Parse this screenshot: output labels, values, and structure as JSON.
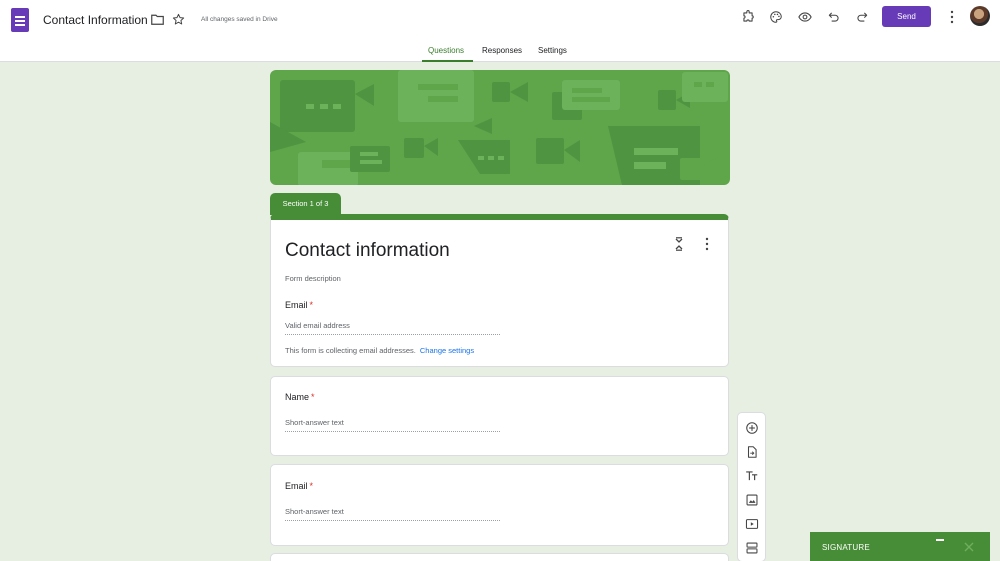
{
  "app": {
    "document_title": "Contact Information",
    "save_status": "All changes saved in Drive",
    "send_label": "Send"
  },
  "tabs": [
    {
      "label": "Questions",
      "active": true
    },
    {
      "label": "Responses",
      "active": false
    },
    {
      "label": "Settings",
      "active": false
    }
  ],
  "toolbar_icons": [
    "add-ons-icon",
    "palette-icon",
    "preview-icon",
    "undo-icon",
    "redo-icon",
    "more-vert-icon"
  ],
  "section": {
    "badge": "Section 1 of 3",
    "title": "Contact information",
    "description_placeholder": "Form description",
    "email_label": "Email",
    "email_placeholder": "Valid email address",
    "collecting_note": "This form is collecting email addresses.",
    "change_settings_label": "Change settings"
  },
  "questions": [
    {
      "label": "Name",
      "required": true,
      "placeholder": "Short-answer text"
    },
    {
      "label": "Email",
      "required": true,
      "placeholder": "Short-answer text"
    }
  ],
  "floating_toolbar_icons": [
    "add-question-icon",
    "import-questions-icon",
    "add-title-icon",
    "add-image-icon",
    "add-video-icon",
    "add-section-icon"
  ],
  "signature_panel": {
    "label": "SIGNATURE"
  },
  "colors": {
    "brand": "#673ab7",
    "theme": "#478d37",
    "banner": "#5fa54a",
    "background": "#e6efe2",
    "link": "#1a73e8",
    "required": "#d93025"
  }
}
